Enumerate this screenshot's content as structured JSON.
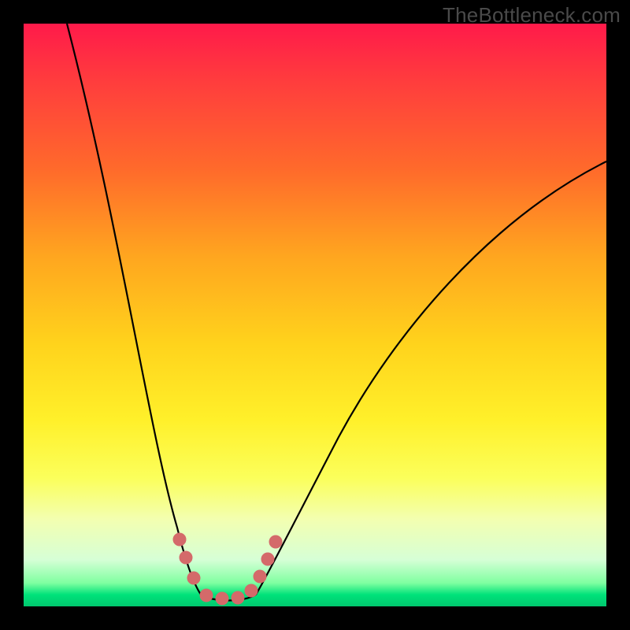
{
  "watermark": "TheBottleneck.com",
  "chart_data": {
    "type": "line",
    "title": "",
    "xlabel": "",
    "ylabel": "",
    "xlim": [
      0,
      100
    ],
    "ylim": [
      0,
      100
    ],
    "grid": false,
    "legend": false,
    "background": "vertical-heat-gradient (red→orange→yellow→green)",
    "series": [
      {
        "name": "bottleneck-curve",
        "x": [
          7,
          12,
          17,
          22,
          26,
          28,
          30,
          32,
          34,
          36,
          38,
          40,
          44,
          50,
          58,
          70,
          85,
          100
        ],
        "y": [
          100,
          72,
          48,
          28,
          14,
          8,
          3,
          1,
          0.5,
          0.5,
          1,
          3,
          10,
          22,
          38,
          55,
          68,
          77
        ],
        "description": "V-shaped curve: steep fall on the left, flat minimum ≈30–36 on the x-axis, shallower rise to the right. Values are visual estimates from an unlabeled plot."
      },
      {
        "name": "highlighted-points",
        "x": [
          27,
          28,
          29,
          31,
          33,
          35,
          37,
          39,
          41,
          43
        ],
        "y": [
          12,
          9,
          5,
          2,
          1,
          1,
          2,
          4,
          7,
          11
        ],
        "marker": "circle",
        "color": "#d46a6a"
      }
    ],
    "annotations": [
      {
        "text": "TheBottleneck.com",
        "position": "top-right",
        "role": "watermark"
      }
    ]
  }
}
